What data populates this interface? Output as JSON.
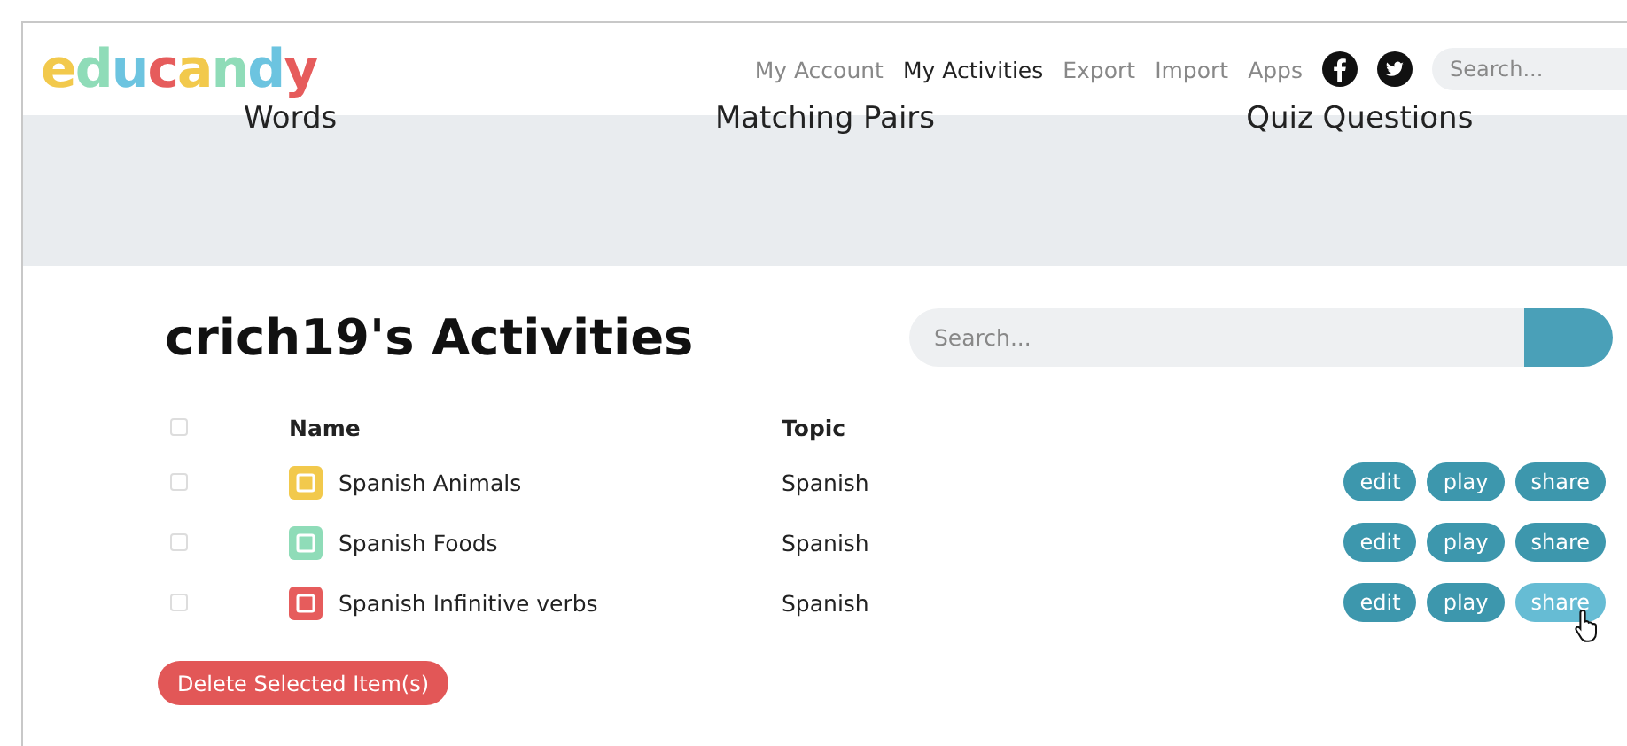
{
  "header": {
    "logo": "educandy",
    "nav": [
      {
        "label": "My Account",
        "selected": false
      },
      {
        "label": "My Activities",
        "selected": true
      },
      {
        "label": "Export",
        "selected": false
      },
      {
        "label": "Import",
        "selected": false
      },
      {
        "label": "Apps",
        "selected": false
      }
    ],
    "search": {
      "placeholder": "Search..."
    }
  },
  "banner": {
    "items": [
      "Words",
      "Matching Pairs",
      "Quiz Questions"
    ]
  },
  "activities": {
    "title": "crich19's Activities",
    "search": {
      "placeholder": "Search..."
    },
    "columns": [
      "Name",
      "Topic"
    ],
    "header_checkbox": {
      "checked": false
    },
    "rows": [
      {
        "name": "Spanish Animals",
        "topic": "Spanish",
        "checked": false,
        "color": "#f2c94c",
        "actions": [
          {
            "label": "edit",
            "hovered": false
          },
          {
            "label": "play",
            "hovered": false
          },
          {
            "label": "share",
            "hovered": false
          }
        ]
      },
      {
        "name": "Spanish Foods",
        "topic": "Spanish",
        "checked": false,
        "color": "#8fdcb8",
        "actions": [
          {
            "label": "edit",
            "hovered": false
          },
          {
            "label": "play",
            "hovered": false
          },
          {
            "label": "share",
            "hovered": false
          }
        ]
      },
      {
        "name": "Spanish Infinitive verbs",
        "topic": "Spanish",
        "checked": false,
        "color": "#e65c5c",
        "actions": [
          {
            "label": "edit",
            "hovered": false
          },
          {
            "label": "play",
            "hovered": false
          },
          {
            "label": "share",
            "hovered": true
          }
        ]
      }
    ],
    "delete_button": "Delete Selected Item(s)"
  }
}
